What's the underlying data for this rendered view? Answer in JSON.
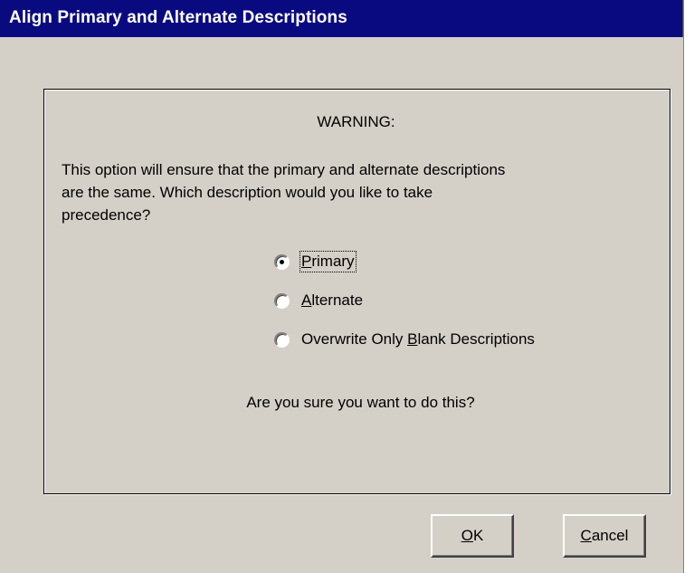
{
  "window": {
    "title": "Align Primary and Alternate Descriptions"
  },
  "warning": {
    "heading": "WARNING:",
    "message": "This option will ensure that the primary and alternate descriptions\nare the same.  Which description would you like to take\nprecedence?"
  },
  "options": [
    {
      "label_pre": "",
      "mnemonic": "P",
      "label_post": "rimary",
      "checked": true
    },
    {
      "label_pre": "",
      "mnemonic": "A",
      "label_post": "lternate",
      "checked": false
    },
    {
      "label_pre": "Overwrite Only ",
      "mnemonic": "B",
      "label_post": "lank Descriptions",
      "checked": false
    }
  ],
  "confirm": {
    "question": "Are you sure you want to do this?"
  },
  "buttons": {
    "ok": {
      "mnemonic": "O",
      "rest": "K"
    },
    "cancel": {
      "mnemonic": "C",
      "rest": "ancel"
    }
  }
}
